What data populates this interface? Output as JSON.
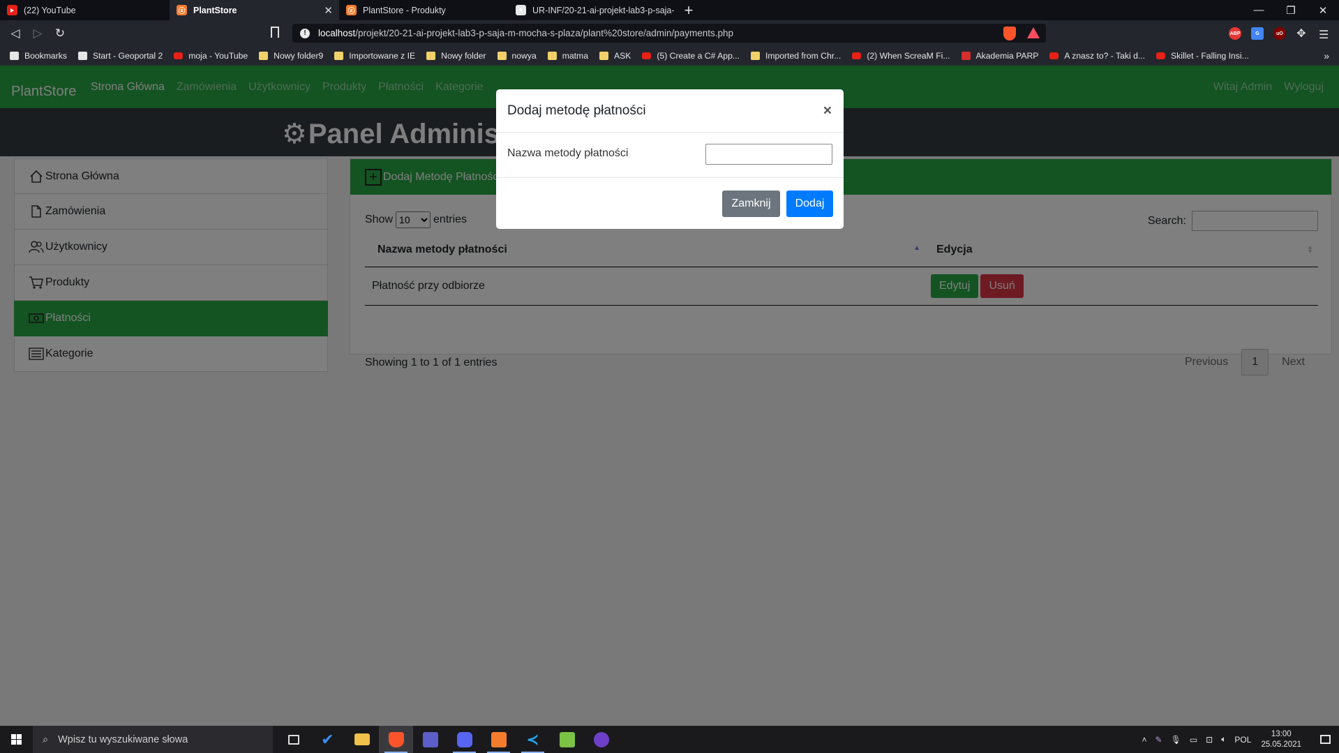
{
  "browser": {
    "tabs": [
      {
        "title": "(22) YouTube",
        "favicon": "youtube-icon",
        "active": false
      },
      {
        "title": "PlantStore",
        "favicon": "xampp-icon",
        "active": true
      },
      {
        "title": "PlantStore - Produkty",
        "favicon": "xampp-icon",
        "active": false
      },
      {
        "title": "UR-INF/20-21-ai-projekt-lab3-p-saja-",
        "favicon": "github-icon",
        "active": false
      }
    ],
    "new_tab": "+",
    "url_host": "localhost",
    "url_path": "/projekt/20-21-ai-projekt-lab3-p-saja-m-mocha-s-plaza/plant%20store/admin/payments.php",
    "bookmarks": [
      {
        "label": "Bookmarks",
        "icon": "bookmarks-icon"
      },
      {
        "label": "Start - Geoportal 2",
        "icon": "page-icon"
      },
      {
        "label": "moja - YouTube",
        "icon": "youtube-icon"
      },
      {
        "label": "Nowy folder9",
        "icon": "folder-icon"
      },
      {
        "label": "Importowane z IE",
        "icon": "folder-icon"
      },
      {
        "label": "Nowy folder",
        "icon": "folder-icon"
      },
      {
        "label": "nowya",
        "icon": "folder-icon"
      },
      {
        "label": "matma",
        "icon": "folder-icon"
      },
      {
        "label": "ASK",
        "icon": "folder-icon"
      },
      {
        "label": "(5) Create a C# App...",
        "icon": "youtube-icon"
      },
      {
        "label": "Imported from Chr...",
        "icon": "folder-icon"
      },
      {
        "label": "(2) When ScreaM Fi...",
        "icon": "youtube-icon"
      },
      {
        "label": "Akademia PARP",
        "icon": "parp-icon"
      },
      {
        "label": "A znasz to? - Taki d...",
        "icon": "youtube-icon"
      },
      {
        "label": "Skillet - Falling Insi...",
        "icon": "youtube-icon"
      }
    ],
    "bookmarks_more": "»"
  },
  "site": {
    "brand": "PlantStore",
    "nav": [
      "Strona Główna",
      "Zamówienia",
      "Użytkownicy",
      "Produkty",
      "Płatności",
      "Kategorie"
    ],
    "nav_right": [
      "Witaj Admin",
      "Wyloguj"
    ],
    "admin_title": "Panel Administ",
    "sidebar": [
      {
        "label": "Strona Główna",
        "icon": "home-icon",
        "active": false
      },
      {
        "label": "Zamówienia",
        "icon": "document-icon",
        "active": false
      },
      {
        "label": "Użytkownicy",
        "icon": "users-icon",
        "active": false
      },
      {
        "label": "Produkty",
        "icon": "cart-icon",
        "active": false
      },
      {
        "label": "Płatności",
        "icon": "cash-icon",
        "active": true
      },
      {
        "label": "Kategorie",
        "icon": "list-icon",
        "active": false
      }
    ],
    "add_header": "Dodaj Metodę Płatności",
    "table": {
      "show_label": "Show",
      "entries_label": "entries",
      "page_length": "10",
      "search_label": "Search:",
      "columns": [
        "Nazwa metody płatności",
        "Edycja"
      ],
      "rows": [
        {
          "name": "Płatność przy odbiorze",
          "edit_label": "Edytuj",
          "delete_label": "Usuń"
        }
      ],
      "info": "Showing 1 to 1 of 1 entries",
      "previous": "Previous",
      "current_page": "1",
      "next": "Next"
    }
  },
  "modal": {
    "title": "Dodaj metodę płatności",
    "close": "×",
    "field_label": "Nazwa metody płatności",
    "field_value": "",
    "cancel_label": "Zamknij",
    "submit_label": "Dodaj"
  },
  "taskbar": {
    "search_placeholder": "Wpisz tu wyszukiwane słowa",
    "language": "POL",
    "time": "13:00",
    "date": "25.05.2021"
  },
  "colors": {
    "primary_green": "#28a745",
    "danger_red": "#dc3545",
    "primary_blue": "#007bff",
    "secondary_grey": "#6c757d",
    "dark_header": "#343a40"
  }
}
